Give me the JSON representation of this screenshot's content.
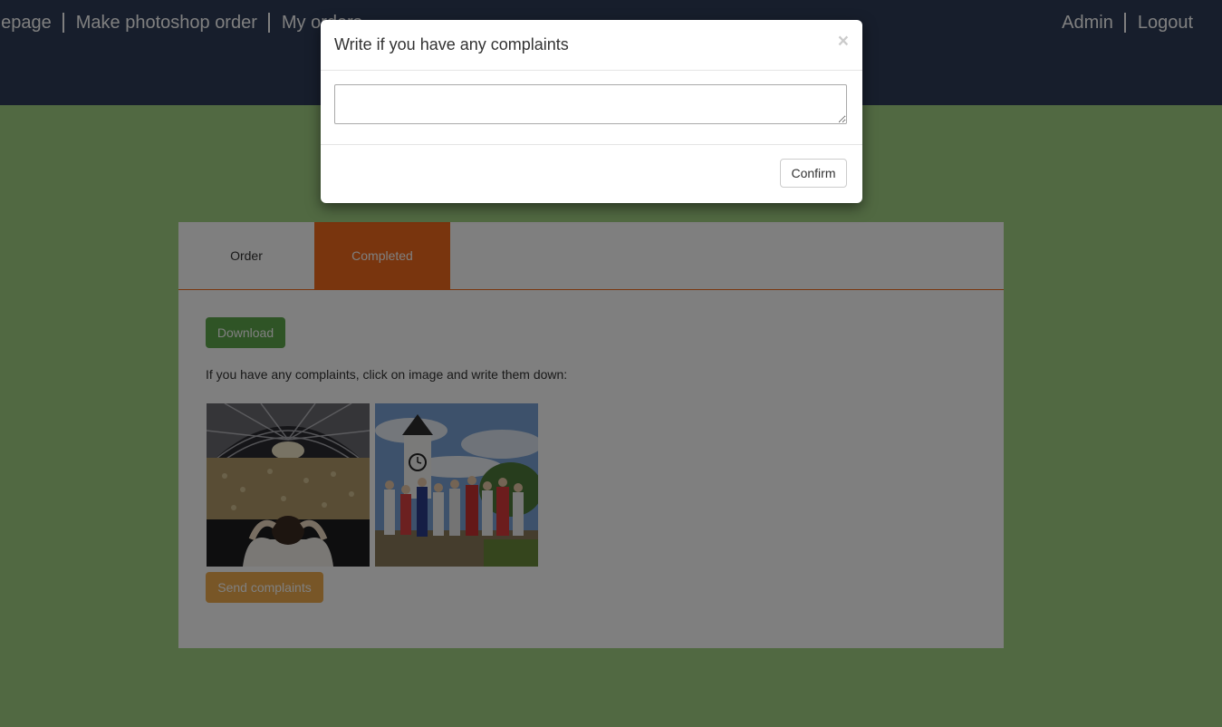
{
  "nav": {
    "left_items": [
      "nepage",
      "Make photoshop order",
      "My orders"
    ],
    "right_items": [
      "Admin",
      "Logout"
    ]
  },
  "tabs": [
    {
      "label": "Order",
      "active": false
    },
    {
      "label": "Completed",
      "active": true
    }
  ],
  "content": {
    "download_label": "Download",
    "instructions": "If you have any complaints, click on image and write them down:",
    "images": [
      {
        "subject": "concert-crowd-photo"
      },
      {
        "subject": "clock-tower-group-photo"
      }
    ],
    "send_label": "Send complaints"
  },
  "modal": {
    "title": "Write if you have any complaints",
    "close_symbol": "×",
    "textarea_value": "",
    "confirm_label": "Confirm"
  },
  "colors": {
    "navbar": "#2f3d59",
    "background": "#a2d384",
    "accent_tab": "#f26b1d",
    "download_button": "#5fa84c",
    "send_button": "#f0ad4e"
  }
}
